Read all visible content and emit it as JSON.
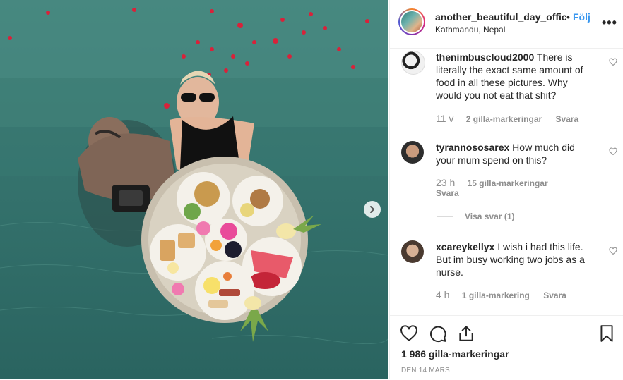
{
  "post": {
    "username": "another_beautiful_day_offic",
    "separator": "•",
    "follow_label": "Följ",
    "location": "Kathmandu, Nepal",
    "more_label": "•••"
  },
  "comments": [
    {
      "username": "thenimbuscloud2000",
      "text": "There is literally the exact same amount of food in all these pictures. Why would you not eat that shit?",
      "age": "11 v",
      "likes": "2 gilla-markeringar",
      "reply": "Svara"
    },
    {
      "username": "tyrannososarex",
      "text": "How much did your mum spend on this?",
      "age": "23 h",
      "likes": "15 gilla-markeringar",
      "reply": "Svara"
    },
    {
      "username": "xcareykellyx",
      "text": "I wish i had this life. But im busy working two jobs as a nurse.",
      "age": "4 h",
      "likes": "1 gilla-markering",
      "reply": "Svara"
    }
  ],
  "view_replies_label": "Visa svar (1)",
  "footer": {
    "likes_total": "1 986 gilla-markeringar",
    "date": "DEN 14 MARS"
  },
  "icons": {
    "heart": "heart-icon",
    "comment": "comment-icon",
    "share": "share-icon",
    "bookmark": "bookmark-icon",
    "next": "chevron-right-icon"
  },
  "colors": {
    "link_blue": "#3897f0",
    "muted_gray": "#8e8e8e",
    "text": "#262626"
  }
}
